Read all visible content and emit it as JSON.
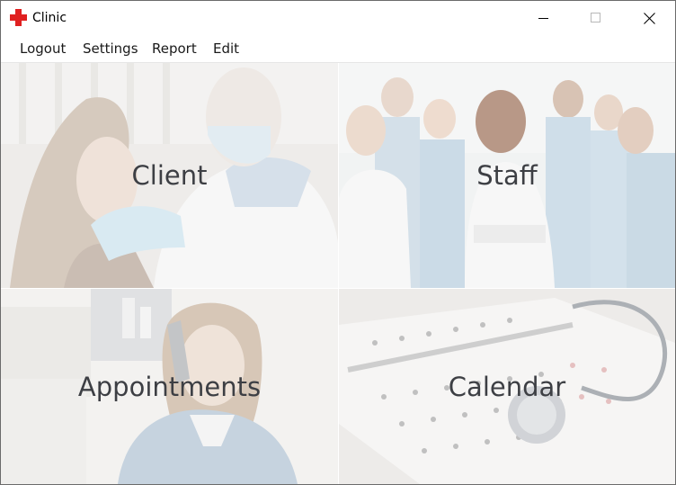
{
  "window": {
    "title": "Clinic",
    "icon": "red-cross-icon",
    "controls": [
      "minimize-icon",
      "maximize-icon",
      "close-icon"
    ]
  },
  "menu": {
    "logout": "Logout",
    "settings": "Settings",
    "report": "Report",
    "edit": "Edit"
  },
  "tiles": {
    "client": "Client",
    "staff": "Staff",
    "appointments": "Appointments",
    "calendar": "Calendar"
  },
  "colors": {
    "brand_red": "#e02020",
    "tile_label": "#3d3f44"
  }
}
